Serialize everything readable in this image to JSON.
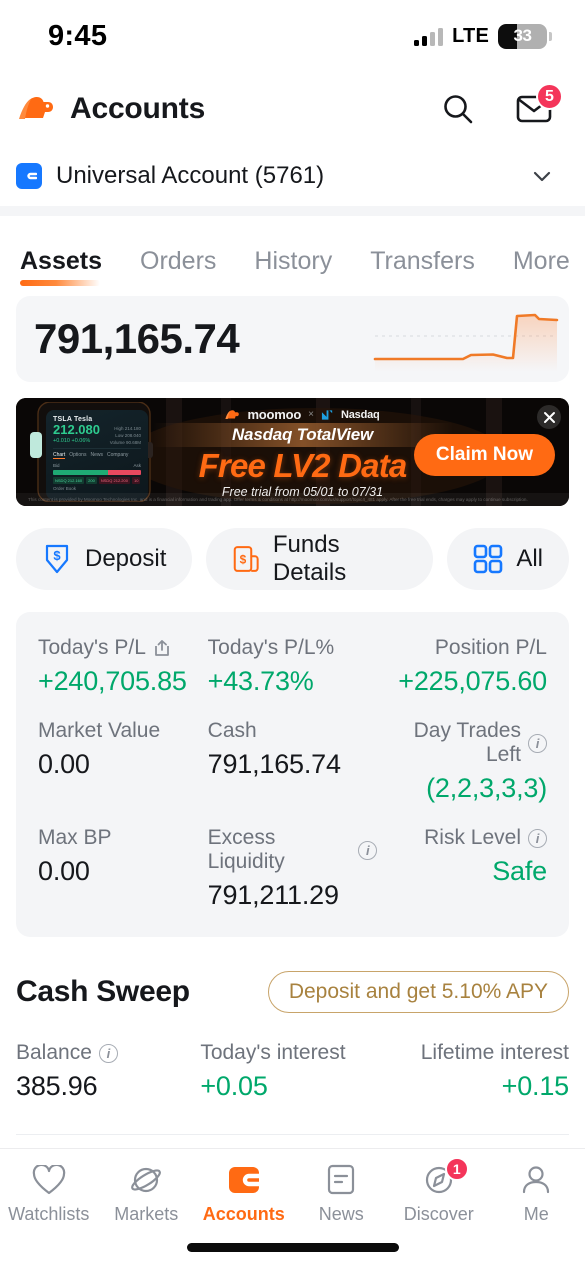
{
  "status_bar": {
    "time": "9:45",
    "network": "LTE",
    "battery_percent": "33",
    "signal_icon": "cellular-signal-icon",
    "battery_icon": "battery-icon"
  },
  "header": {
    "logo_icon": "moomoo-bull-logo-icon",
    "title": "Accounts",
    "search_icon": "search-icon",
    "mail_icon": "mail-icon",
    "mail_badge": "5"
  },
  "account_selector": {
    "icon": "wallet-account-icon",
    "name": "Universal Account (5761)",
    "chevron_icon": "chevron-down-icon"
  },
  "tabs": [
    {
      "label": "Assets",
      "active": true
    },
    {
      "label": "Orders",
      "active": false
    },
    {
      "label": "History",
      "active": false
    },
    {
      "label": "Transfers",
      "active": false
    },
    {
      "label": "More",
      "active": false
    }
  ],
  "balance": {
    "value": "791,165.74",
    "sparkline_icon": "balance-sparkline-chart"
  },
  "banner": {
    "brand_left": "moomoo",
    "brand_sep": "×",
    "brand_right": "Nasdaq",
    "eyebrow": "Nasdaq TotalView",
    "headline": "Free LV2 Data",
    "subline": "Free trial from 05/01 to 07/31",
    "cta_label": "Claim Now",
    "close_icon": "close-icon",
    "legal": "This content is provided by Moomoo Technologies Inc. and is a financial information and trading app. Offer terms & conditions at http://moomoo.com/us/support/topic4_481 apply. After the free trial ends, charges may apply to continue subscription.",
    "phone_mock": {
      "symbol": "TSLA",
      "company": "Tesla",
      "price": "212.080",
      "change": "+0.010  +0.06%",
      "stats": [
        "High  214.180",
        "Low  208.040",
        "Volume  90.68M"
      ],
      "tabs": [
        "Chart",
        "Options",
        "News",
        "Company"
      ],
      "bid_label": "Bid",
      "ask_label": "Ask",
      "bid_pct": "66.67%",
      "ask_pct": "33.33%",
      "rows": [
        {
          "left": "NSDQ 212.160",
          "mid": "200",
          "right": "NSDQ 212.200",
          "qty": "10"
        }
      ],
      "order_book_label": "Order Book"
    }
  },
  "quick_actions": [
    {
      "label": "Deposit",
      "icon": "deposit-arrow-icon"
    },
    {
      "label": "Funds Details",
      "icon": "funds-details-icon"
    },
    {
      "label": "All",
      "icon": "grid-all-icon"
    }
  ],
  "stats": [
    {
      "label": "Today's P/L",
      "value": "+240,705.85",
      "green": true,
      "icon": "share-icon",
      "align": "left"
    },
    {
      "label": "Today's P/L%",
      "value": "+43.73%",
      "green": true,
      "icon": null,
      "align": "left"
    },
    {
      "label": "Position P/L",
      "value": "+225,075.60",
      "green": true,
      "icon": null,
      "align": "right"
    },
    {
      "label": "Market Value",
      "value": "0.00",
      "green": false,
      "icon": null,
      "align": "left"
    },
    {
      "label": "Cash",
      "value": "791,165.74",
      "green": false,
      "icon": null,
      "align": "left"
    },
    {
      "label": "Day Trades Left",
      "value": "(2,2,3,3,3)",
      "green": true,
      "icon": "info-icon",
      "align": "right"
    },
    {
      "label": "Max BP",
      "value": "0.00",
      "green": false,
      "icon": null,
      "align": "left"
    },
    {
      "label": "Excess Liquidity",
      "value": "791,211.29",
      "green": false,
      "icon": "info-icon",
      "align": "left"
    },
    {
      "label": "Risk Level",
      "value": "Safe",
      "green": true,
      "icon": "info-icon",
      "align": "right"
    }
  ],
  "cash_sweep": {
    "title": "Cash Sweep",
    "apy_pill": "Deposit and get 5.10% APY",
    "items": [
      {
        "label": "Balance",
        "value": "385.96",
        "green": false,
        "icon": "info-icon",
        "align": "left"
      },
      {
        "label": "Today's interest",
        "value": "+0.05",
        "green": true,
        "icon": null,
        "align": "left"
      },
      {
        "label": "Lifetime interest",
        "value": "+0.15",
        "green": true,
        "icon": null,
        "align": "right"
      }
    ]
  },
  "bottom_nav": [
    {
      "label": "Watchlists",
      "icon": "heart-icon",
      "active": false,
      "badge": null
    },
    {
      "label": "Markets",
      "icon": "planet-icon",
      "active": false,
      "badge": null
    },
    {
      "label": "Accounts",
      "icon": "wallet-icon",
      "active": true,
      "badge": null
    },
    {
      "label": "News",
      "icon": "news-document-icon",
      "active": false,
      "badge": null
    },
    {
      "label": "Discover",
      "icon": "compass-icon",
      "active": false,
      "badge": "1"
    },
    {
      "label": "Me",
      "icon": "person-icon",
      "active": false,
      "badge": null
    }
  ],
  "colors": {
    "accent_orange": "#ff6a13",
    "positive_green": "#00a86b",
    "badge_red": "#f4355a",
    "blue": "#1678ff",
    "gold": "#a8823f"
  }
}
